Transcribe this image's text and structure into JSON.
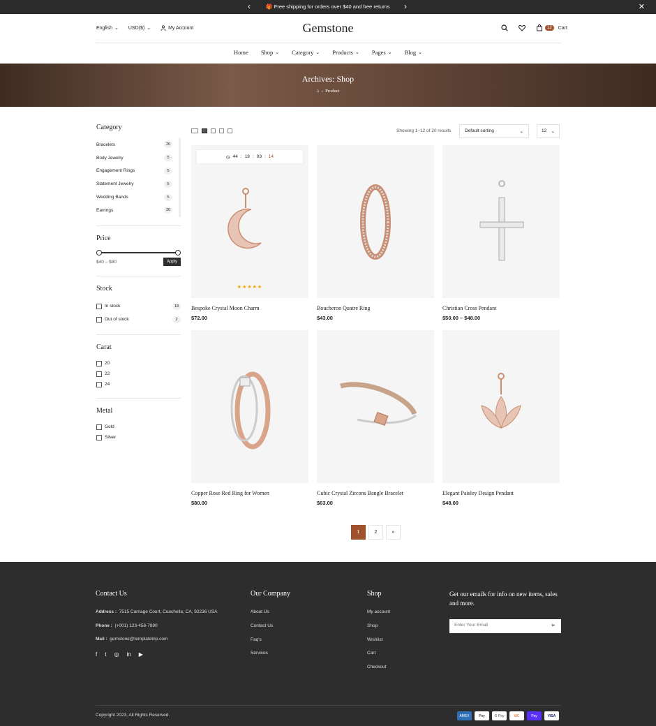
{
  "topbar": {
    "prev": "‹",
    "next": "›",
    "message": "🎁 Free shipping for orders over $40 and free returns",
    "close": "✕"
  },
  "header": {
    "language": "English",
    "currency": "USD($)",
    "account": "My Account",
    "logo": "Gemstone",
    "cart_count": "12",
    "cart_label": "Cart"
  },
  "nav": [
    {
      "label": "Home",
      "dd": ""
    },
    {
      "label": "Shop",
      "dd": "⌄"
    },
    {
      "label": "Category",
      "dd": "⌄"
    },
    {
      "label": "Products",
      "dd": "⌄"
    },
    {
      "label": "Pages",
      "dd": "⌄"
    },
    {
      "label": "Blog",
      "dd": "⌄"
    }
  ],
  "hero": {
    "title": "Archives: Shop",
    "home_icon": "⌂",
    "sep": "›",
    "crumb": "Product"
  },
  "sidebar": {
    "category_title": "Category",
    "categories": [
      {
        "n": "Bracelets",
        "c": "20"
      },
      {
        "n": "Body Jewelry",
        "c": "5"
      },
      {
        "n": "Engagement Rings",
        "c": "5"
      },
      {
        "n": "Statement Jewelry",
        "c": "5"
      },
      {
        "n": "Wedding Bands",
        "c": "5"
      },
      {
        "n": "Earrings",
        "c": "20"
      }
    ],
    "price_title": "Price",
    "price_range": "$40 – $80",
    "apply": "Apply",
    "stock_title": "Stock",
    "stock": [
      {
        "n": "In stock",
        "c": "18"
      },
      {
        "n": "Out of stock",
        "c": "2"
      }
    ],
    "carat_title": "Carat",
    "carats": [
      "20",
      "22",
      "24"
    ],
    "metal_title": "Metal",
    "metals": [
      "Gold",
      "Silver"
    ]
  },
  "toolbar": {
    "showing": "Showing 1–12 of 20 results",
    "sort": "Default sorting",
    "per_page": "12"
  },
  "timer": {
    "h": "44",
    "m": "19",
    "s": "03",
    "ms": "14"
  },
  "products": [
    {
      "name": "Bespoke Crystal Moon Charm",
      "price": "$72.00",
      "icon": "moon-pendant-icon",
      "stars": "★★★★★"
    },
    {
      "name": "Boucheron Quatre Ring",
      "price": "$43.00",
      "icon": "ring-icon"
    },
    {
      "name": "Christian Cross Pendant",
      "price": "$50.00 – $48.00",
      "icon": "cross-pendant-icon"
    },
    {
      "name": "Copper Rose Red Ring for Women",
      "price": "$80.00",
      "icon": "ring-icon"
    },
    {
      "name": "Cubic Crystal Zircons Bangle Bracelet",
      "price": "$63.00",
      "icon": "bracelet-icon"
    },
    {
      "name": "Elegant Paisley Design Pendant",
      "price": "$48.00",
      "icon": "lotus-pendant-icon"
    }
  ],
  "pagination": [
    "1",
    "2",
    "»"
  ],
  "footer": {
    "contact_title": "Contact Us",
    "address_label": "Address :",
    "address": "7515 Carriage Court, Coachella, CA, 92236 USA",
    "phone_label": "Phone :",
    "phone": "(+001) 123-456-7890",
    "mail_label": "Mail :",
    "mail": "gemstone@templatetrip.com",
    "company_title": "Our Company",
    "company_links": [
      "About Us",
      "Contact Us",
      "Faq's",
      "Services"
    ],
    "shop_title": "Shop",
    "shop_links": [
      "My account",
      "Shop",
      "Wishlist",
      "Cart",
      "Checkout"
    ],
    "newsletter": "Get our emails for info on new items, sales and more.",
    "email_placeholder": "Enter Your Email",
    "copyright": "Copyright 2023, All Rights Reserved.",
    "payments": [
      "AMEX",
      "Pay",
      "G Pay",
      "MC",
      "Pay",
      "VISA"
    ]
  },
  "colors": {
    "accent": "#a0522d",
    "dark": "#2d2d2d"
  }
}
